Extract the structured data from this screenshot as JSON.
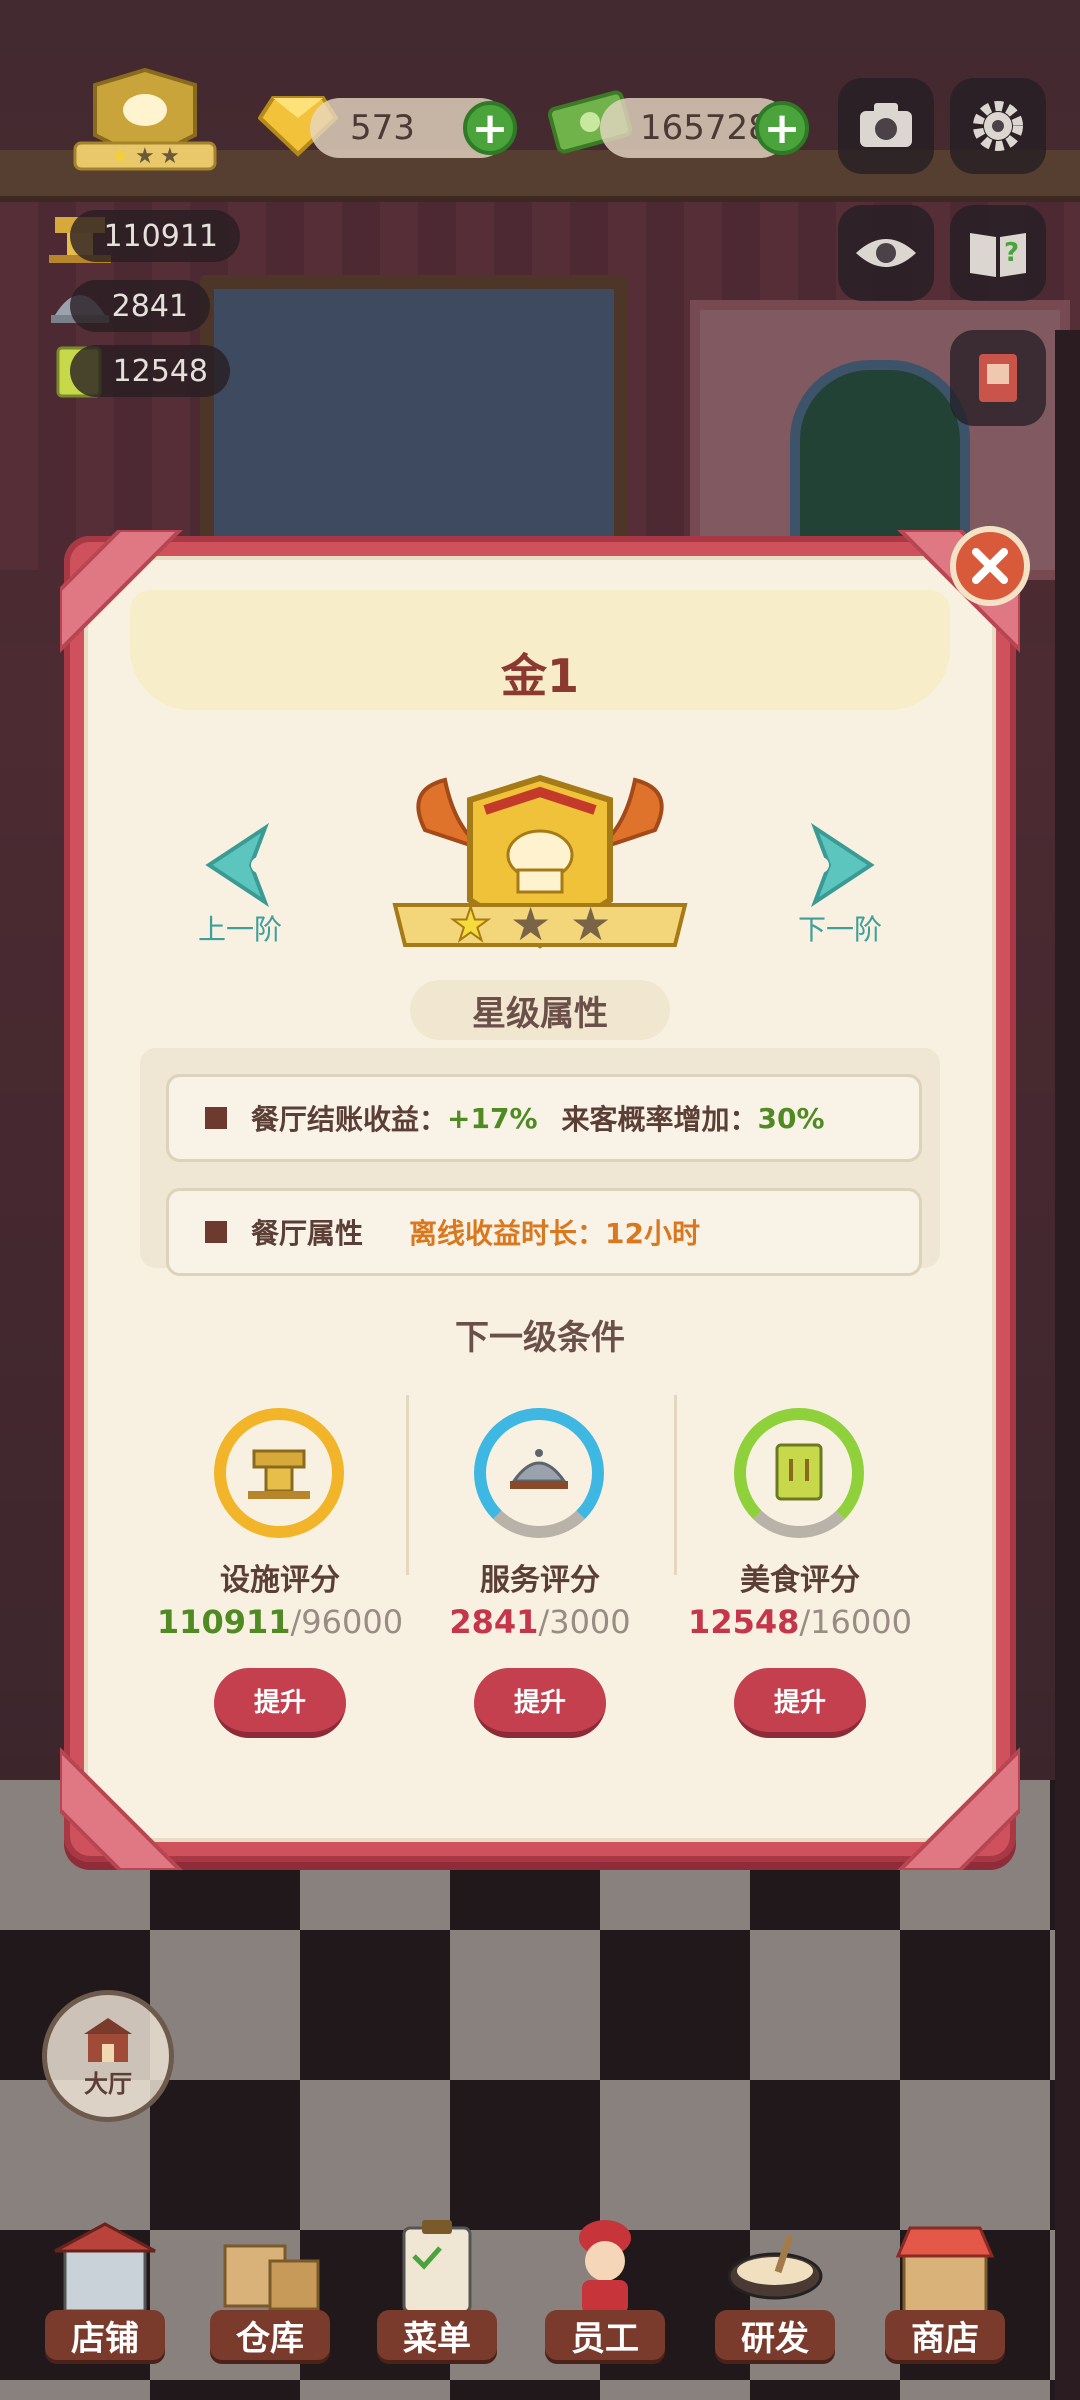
{
  "hud": {
    "gems": "573",
    "cash": "165728",
    "facility_score": "110911",
    "service_score": "2841",
    "food_score": "12548"
  },
  "modal": {
    "title": "金1",
    "prev_label": "上一阶",
    "next_label": "下一阶",
    "rank_stars_filled": 1,
    "rank_stars_total": 3,
    "section_title": "星级属性",
    "attr1": {
      "label": "餐厅结账收益：",
      "value": "+17%",
      "label2": "来客概率增加：",
      "value2": "30%"
    },
    "attr2": {
      "label": "餐厅属性",
      "offline_label": "离线收益时长：",
      "offline_value": "12小时"
    },
    "conditions_title": "下一级条件",
    "conditions": [
      {
        "label": "设施评分",
        "current": "110911",
        "target": "/96000",
        "upgrade": "提升",
        "ring_color": "#f2b52a"
      },
      {
        "label": "服务评分",
        "current": "2841",
        "target": "/3000",
        "upgrade": "提升",
        "ring_color": "#3fb7e3"
      },
      {
        "label": "美食评分",
        "current": "12548",
        "target": "/16000",
        "upgrade": "提升",
        "ring_color": "#8fd13a"
      }
    ]
  },
  "bottom_nav": {
    "hall": "大厅",
    "items": [
      "店铺",
      "仓库",
      "菜单",
      "员工",
      "研发",
      "商店"
    ]
  },
  "colors": {
    "modal_border": "#d0515e",
    "upgrade_button": "#c4404f",
    "nav_arrow": "#5cc6be"
  }
}
